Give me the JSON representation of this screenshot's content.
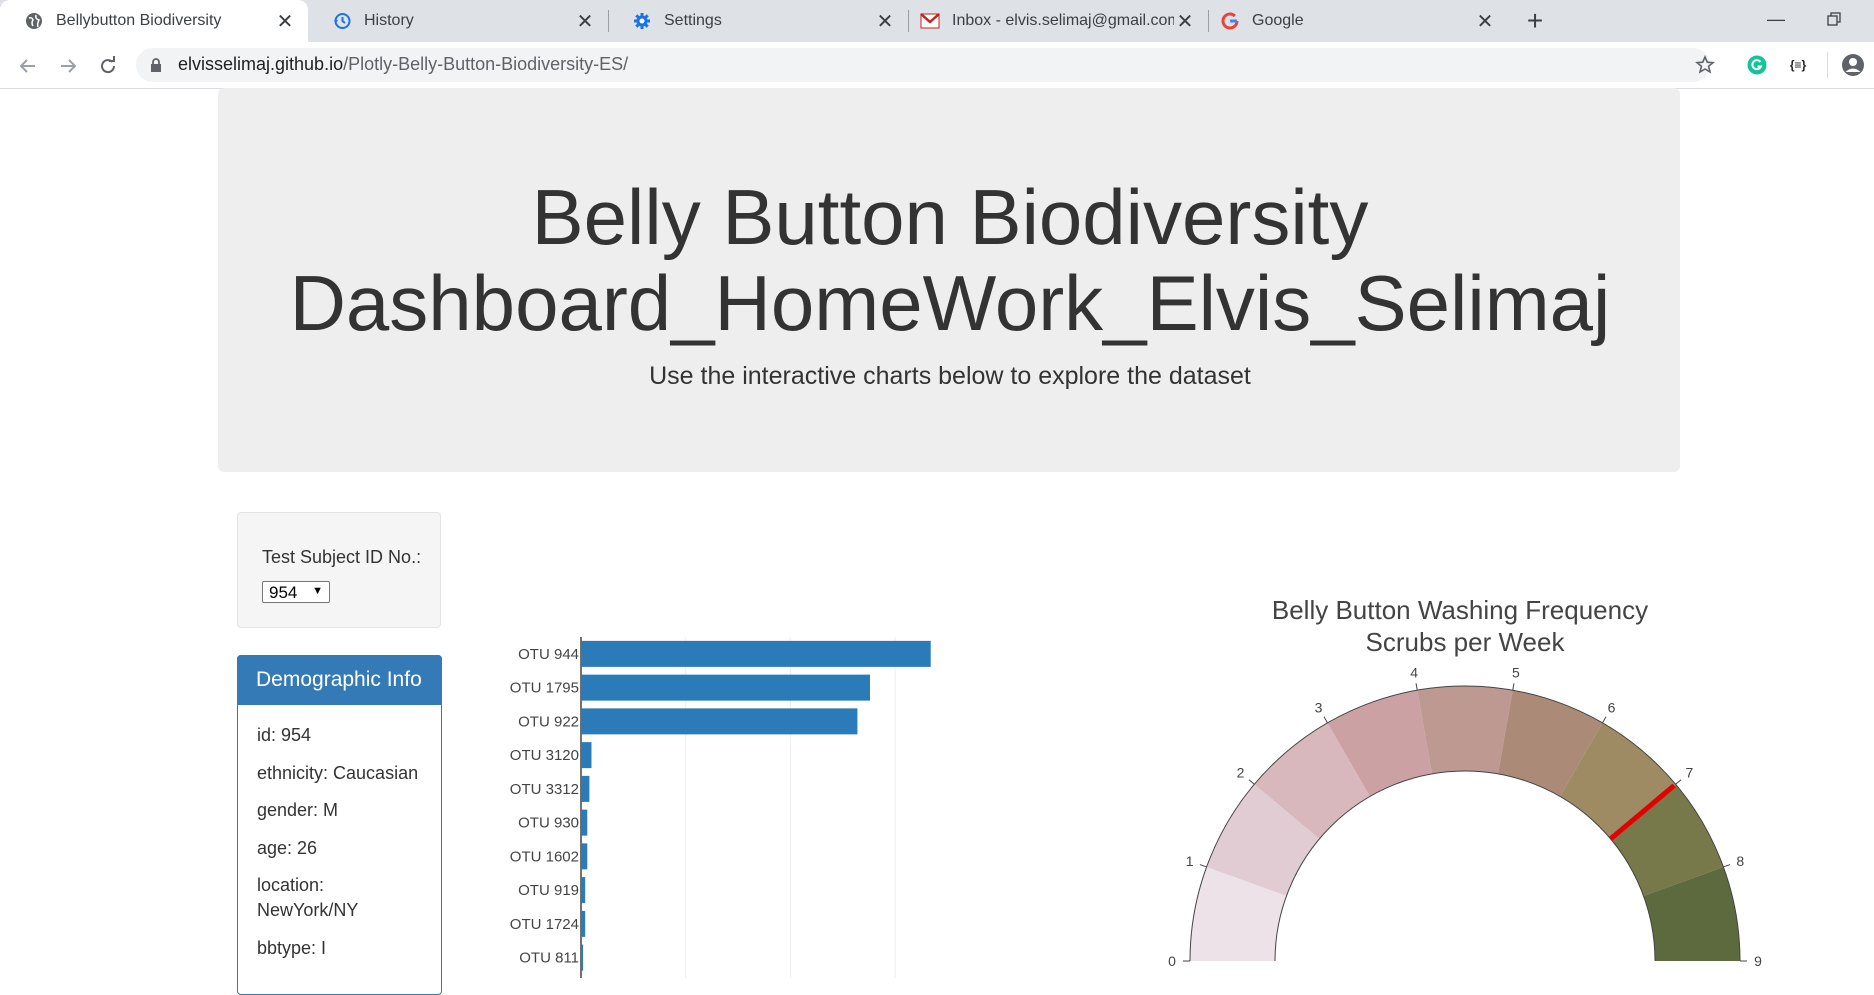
{
  "browser": {
    "tabs": [
      {
        "title": "Bellybutton Biodiversity",
        "icon": "globe-icon",
        "active": true
      },
      {
        "title": "History",
        "icon": "history-icon",
        "active": false
      },
      {
        "title": "Settings",
        "icon": "gear-icon",
        "active": false
      },
      {
        "title": "Inbox - elvis.selimaj@gmail.com",
        "icon": "gmail-icon",
        "active": false
      },
      {
        "title": "Google",
        "icon": "google-icon",
        "active": false
      }
    ],
    "url_host": "elvisselimaj.github.io",
    "url_path": "/Plotly-Belly-Button-Biodiversity-ES/",
    "extension_label": "{≡}"
  },
  "header": {
    "title_line1": "Belly Button Biodiversity",
    "title_line2": "Dashboard_HomeWork_Elvis_Selimaj",
    "subtitle": "Use the interactive charts below to explore the dataset"
  },
  "selector": {
    "label": "Test Subject ID No.:",
    "selected": "954"
  },
  "demographics": {
    "heading": "Demographic Info",
    "lines": [
      "id: 954",
      "ethnicity: Caucasian",
      "gender: M",
      "age: 26",
      "location: NewYork/NY",
      "bbtype: I"
    ]
  },
  "chart_data": [
    {
      "type": "bar",
      "orientation": "horizontal",
      "categories": [
        "OTU 944",
        "OTU 1795",
        "OTU 922",
        "OTU 3120",
        "OTU 3312",
        "OTU 930",
        "OTU 1602",
        "OTU 919",
        "OTU 1724",
        "OTU 811"
      ],
      "values": [
        167,
        138,
        132,
        5,
        4,
        3,
        3,
        2,
        2,
        1
      ],
      "xlim": [
        0,
        170
      ],
      "grid": true,
      "color": "#2b7bb9"
    },
    {
      "type": "gauge",
      "title": "Belly Button Washing Frequency",
      "subtitle": "Scrubs per Week",
      "range": [
        0,
        9
      ],
      "ticks": [
        "0",
        "1",
        "2",
        "3",
        "4",
        "5",
        "6",
        "7",
        "8",
        "9"
      ],
      "value": 7,
      "needle_color": "#e30000",
      "band_colors": [
        "#ede2e7",
        "#e2ccd3",
        "#d8b7bd",
        "#cba1a4",
        "#be9992",
        "#ab8b78",
        "#9e8a63",
        "#78794a",
        "#5d6a3d"
      ]
    }
  ]
}
